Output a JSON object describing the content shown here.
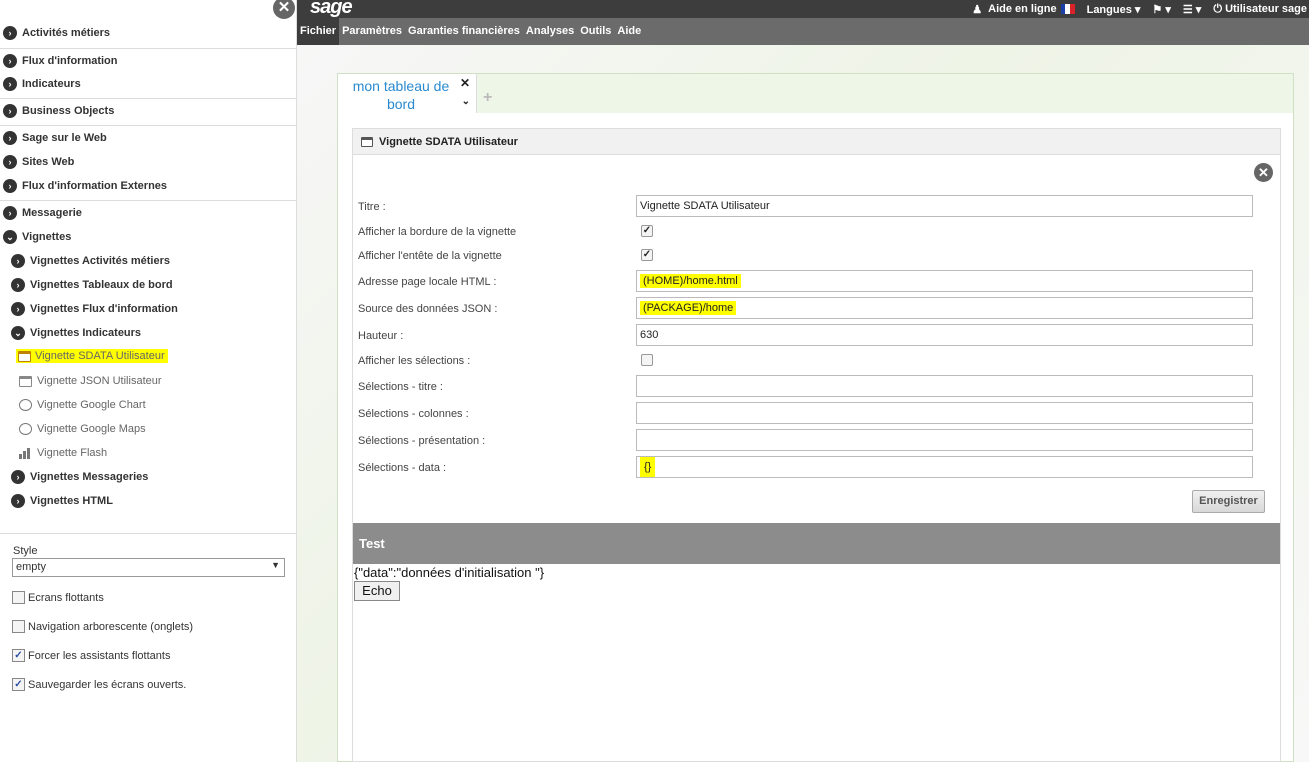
{
  "sidebar": {
    "sections": [
      {
        "label": "Activités métiers",
        "icon": "chevron-right-circle-icon"
      },
      {
        "label": "Flux d'information",
        "icon": "chevron-right-circle-icon"
      },
      {
        "label": "Indicateurs",
        "icon": "chevron-right-circle-icon"
      },
      {
        "label": "Business Objects",
        "icon": "chevron-right-circle-icon"
      },
      {
        "label": "Sage sur le Web",
        "icon": "chevron-right-circle-icon"
      },
      {
        "label": "Sites Web",
        "icon": "chevron-right-circle-icon"
      },
      {
        "label": "Flux d'information Externes",
        "icon": "chevron-right-circle-icon"
      },
      {
        "label": "Messagerie",
        "icon": "chevron-right-circle-icon"
      },
      {
        "label": "Vignettes",
        "icon": "chevron-down-circle-icon"
      }
    ],
    "subsections": [
      {
        "label": "Vignettes Activités métiers"
      },
      {
        "label": "Vignettes Tableaux de bord"
      },
      {
        "label": "Vignettes Flux d'information"
      },
      {
        "label": "Vignettes Indicateurs"
      }
    ],
    "leaf_items": [
      {
        "label": "Vignette SDATA Utilisateur",
        "icon": "window-icon"
      },
      {
        "label": "Vignette JSON Utilisateur",
        "icon": "window-icon"
      },
      {
        "label": "Vignette Google Chart",
        "icon": "globe-icon"
      },
      {
        "label": "Vignette Google Maps",
        "icon": "globe-icon"
      },
      {
        "label": "Vignette Flash",
        "icon": "bar-chart-icon"
      }
    ],
    "more_subsections": [
      {
        "label": "Vignettes Messageries"
      },
      {
        "label": "Vignettes HTML"
      }
    ],
    "style": {
      "label": "Style",
      "value": "empty",
      "checkboxes": [
        {
          "label": "Ecrans flottants",
          "checked": false
        },
        {
          "label": "Navigation arborescente (onglets)",
          "checked": false
        },
        {
          "label": "Forcer les assistants flottants",
          "checked": true
        },
        {
          "label": "Sauvegarder les écrans ouverts.",
          "checked": true
        }
      ]
    }
  },
  "topbar": {
    "logo": "sage",
    "help": "Aide en ligne",
    "languages": "Langues",
    "user": "Utilisateur sage"
  },
  "menu": [
    "Fichier",
    "Paramètres",
    "Garanties financières",
    "Analyses",
    "Outils",
    "Aide"
  ],
  "tab": {
    "title": "mon tableau de bord"
  },
  "card": {
    "title": "Vignette SDATA  Utilisateur",
    "fields": {
      "titre_label": "Titre :",
      "titre_value": "Vignette SDATA  Utilisateur",
      "bordure_label": "Afficher la bordure de la vignette",
      "entete_label": "Afficher l'entête de la vignette",
      "adresse_label": "Adresse page locale HTML :",
      "adresse_value": "(HOME)/home.html",
      "source_label": "Source des données JSON :",
      "source_value": "(PACKAGE)/home",
      "hauteur_label": "Hauteur :",
      "hauteur_value": "630",
      "selections_label": "Afficher les sélections :",
      "sel_titre_label": "Sélections - titre :",
      "sel_colonnes_label": "Sélections - colonnes :",
      "sel_presentation_label": "Sélections - présentation :",
      "sel_data_label": "Sélections - data :",
      "sel_data_value": "{}"
    },
    "save_label": "Enregistrer",
    "test_title": "Test",
    "test_output": "{\"data\":\"données d'initialisation \"}",
    "echo_label": "Echo"
  },
  "colors": {
    "topbar": "#3d3d3d",
    "menubar": "#6b6b6b",
    "link": "#2a8ad0",
    "highlight": "#ffff00"
  }
}
